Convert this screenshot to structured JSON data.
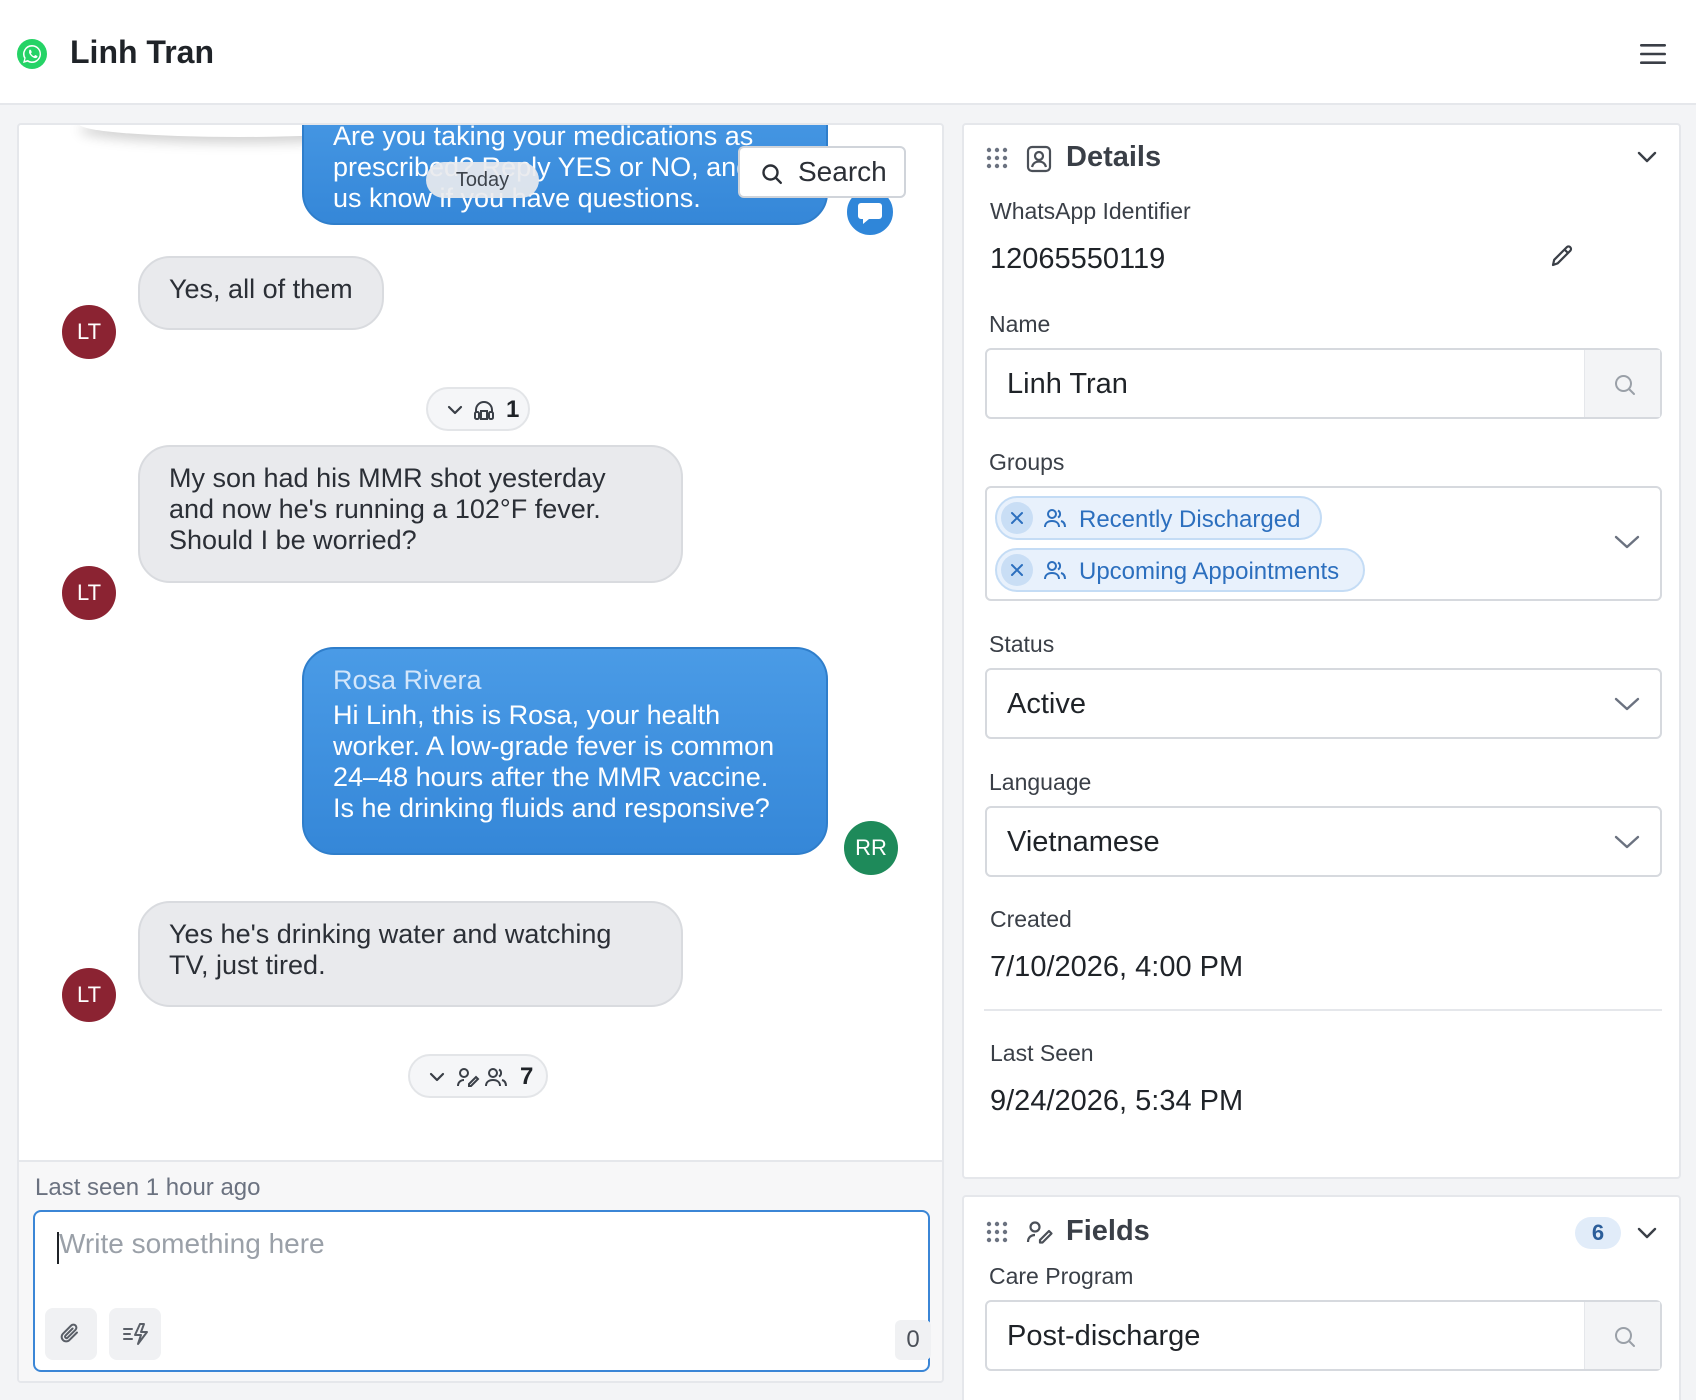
{
  "header": {
    "contact_name": "Linh Tran",
    "channel_icon": "whatsapp-icon",
    "menu_icon": "hamburger-menu-icon"
  },
  "chat": {
    "search_label": "Search",
    "date_separator": "Today",
    "messages": [
      {
        "direction": "outgoing",
        "text_lines": [
          "Are you taking your medications as",
          "prescribed? Reply YES or NO, and let",
          "us know if you have questions."
        ]
      },
      {
        "direction": "incoming",
        "avatar": "LT",
        "text": "Yes, all of them"
      },
      {
        "direction": "incoming",
        "avatar": "LT",
        "text_lines": [
          "My son had his MMR shot yesterday",
          "and now he's running a 102°F fever.",
          "Should I be worried?"
        ]
      },
      {
        "direction": "outgoing",
        "avatar": "RR",
        "sender": "Rosa Rivera",
        "text_lines": [
          "Hi Linh, this is Rosa, your health",
          "worker. A low-grade fever is common",
          "24–48 hours after the MMR vaccine.",
          "Is he drinking fluids and responsive?"
        ]
      },
      {
        "direction": "incoming",
        "avatar": "LT",
        "text_lines": [
          "Yes he's drinking water and watching",
          "TV, just tired."
        ]
      }
    ],
    "event_pills": [
      {
        "count": "1"
      },
      {
        "count": "7"
      }
    ],
    "last_seen": "Last seen 1 hour ago",
    "composer": {
      "placeholder": "Write something here",
      "char_count": "0"
    }
  },
  "details": {
    "title": "Details",
    "whatsapp_identifier_label": "WhatsApp Identifier",
    "whatsapp_identifier": "12065550119",
    "name_label": "Name",
    "name_value": "Linh Tran",
    "groups_label": "Groups",
    "groups": [
      "Recently Discharged",
      "Upcoming Appointments"
    ],
    "status_label": "Status",
    "status_value": "Active",
    "language_label": "Language",
    "language_value": "Vietnamese",
    "created_label": "Created",
    "created_value": "7/10/2026, 4:00 PM",
    "last_seen_label": "Last Seen",
    "last_seen_value": "9/24/2026, 5:34 PM"
  },
  "fields": {
    "title": "Fields",
    "count": "6",
    "care_program_label": "Care Program",
    "care_program_value": "Post-discharge"
  },
  "colors": {
    "outgoing_bubble": "#3587d8",
    "incoming_bubble": "#e9eaed",
    "avatar_lt": "#8b2332",
    "avatar_rr": "#1e8a5a",
    "whatsapp_green": "#25d366",
    "tag_text": "#2c6fbe"
  }
}
